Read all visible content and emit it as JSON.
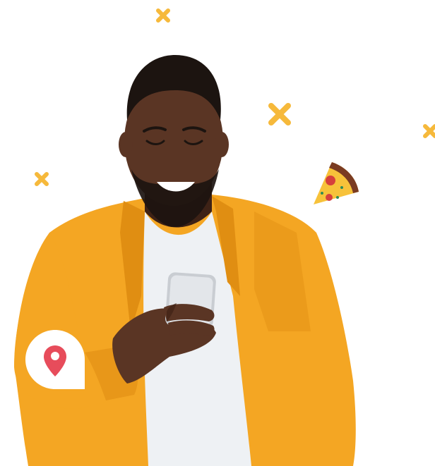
{
  "colors": {
    "background": "#ffffff",
    "accent_yellow": "#F6B93B",
    "shirt_orange": "#F4A623",
    "shirt_shadow": "#E08E12",
    "skin": "#5A3524",
    "skin_dark": "#3E2216",
    "hair": "#1C1410",
    "tshirt": "#EEF1F4",
    "phone": "#C9CDD2",
    "pin_red": "#E74C5B",
    "pizza_crust": "#7A3B22",
    "pizza_cheese": "#F7C23A",
    "pizza_pepperoni": "#D6403C",
    "pizza_herb": "#2E8B57"
  },
  "icons": {
    "location": "map-pin-icon",
    "food": "pizza-slice-icon",
    "decoration": "cross-icon"
  }
}
